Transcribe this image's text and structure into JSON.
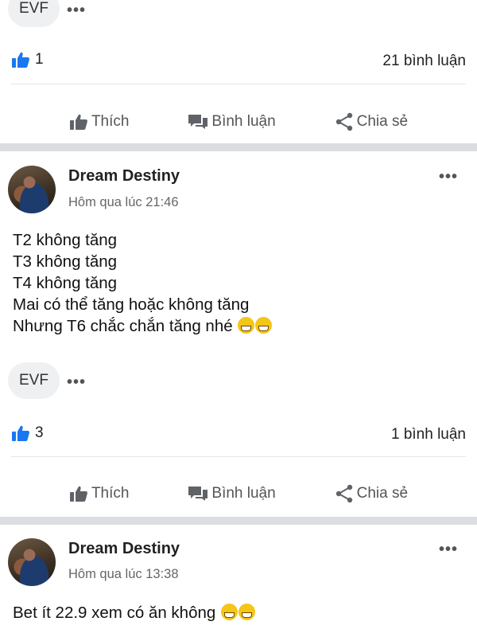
{
  "post1": {
    "tag": "EVF",
    "likes": "1",
    "comments": "21 bình luận"
  },
  "actions": {
    "like": "Thích",
    "comment": "Bình luận",
    "share": "Chia sẻ"
  },
  "post2": {
    "author": "Dream Destiny",
    "time": "Hôm qua lúc 21:46",
    "lines": [
      "T2 không tăng",
      "T3 không tăng",
      "T4 không tăng",
      "Mai có thể tăng hoặc không tăng",
      "Nhưng T6 chắc chắn tăng nhé"
    ],
    "tag": "EVF",
    "likes": "3",
    "comments": "1 bình luận"
  },
  "post3": {
    "author": "Dream Destiny",
    "time": "Hôm qua lúc 13:38",
    "text": "Bet ít 22.9 xem có ăn không"
  },
  "icons": {
    "like_reaction": "thumbs-up-icon",
    "more": "more-icon",
    "like": "like-icon",
    "comment": "comment-icon",
    "share": "share-icon",
    "emoji": "grinning-emoji",
    "accent": "#1877f2"
  }
}
